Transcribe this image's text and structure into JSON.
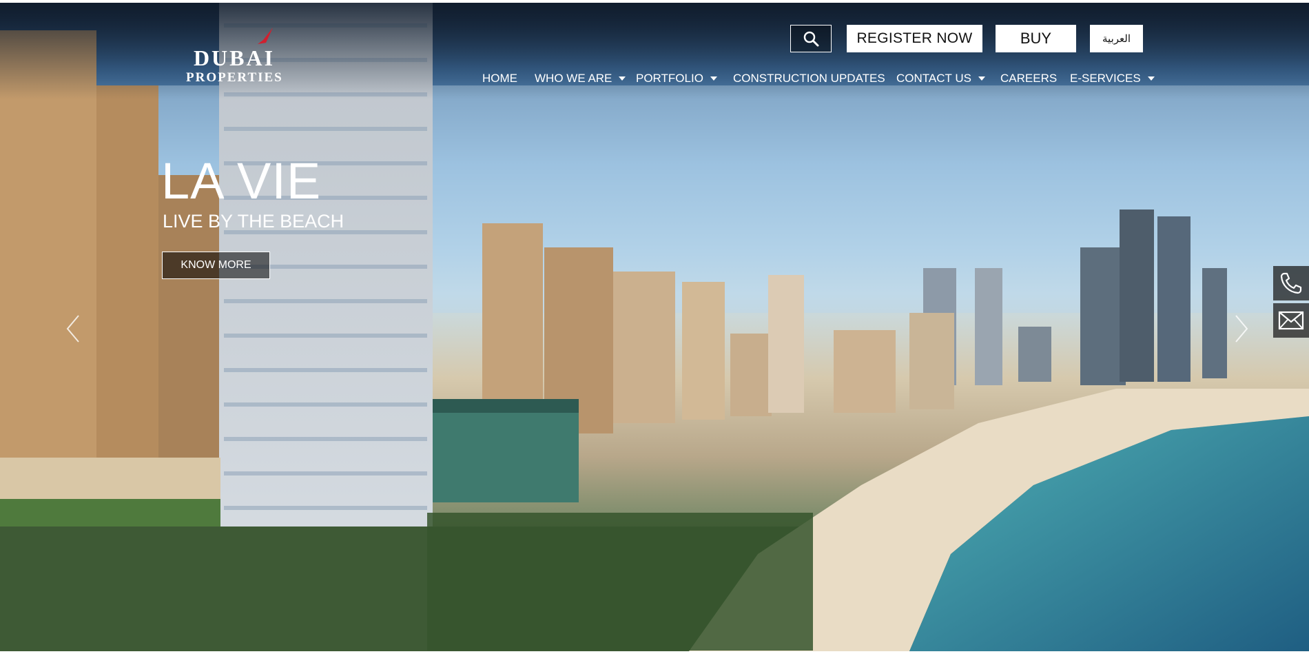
{
  "header": {
    "logo": {
      "main": "DUBAI",
      "sub": "PROPERTIES",
      "accent_color": "#d0202f"
    },
    "search_icon": "search-icon",
    "buttons": {
      "register": "REGISTER NOW",
      "buy": "BUY",
      "language": "العربية"
    }
  },
  "nav": {
    "items": [
      {
        "label": "HOME",
        "dropdown": false
      },
      {
        "label": "WHO WE ARE",
        "dropdown": true
      },
      {
        "label": "PORTFOLIO",
        "dropdown": true
      },
      {
        "label": "CONSTRUCTION UPDATES",
        "dropdown": false
      },
      {
        "label": "CONTACT US",
        "dropdown": true
      },
      {
        "label": "CAREERS",
        "dropdown": false
      },
      {
        "label": "E-SERVICES",
        "dropdown": true
      }
    ]
  },
  "hero": {
    "title": "LA VIE",
    "subtitle": "LIVE BY THE BEACH",
    "cta": "KNOW MORE",
    "prev_icon": "chevron-left-icon",
    "next_icon": "chevron-right-icon"
  },
  "side_contact": {
    "phone_icon": "phone-icon",
    "mail_icon": "mail-icon"
  }
}
